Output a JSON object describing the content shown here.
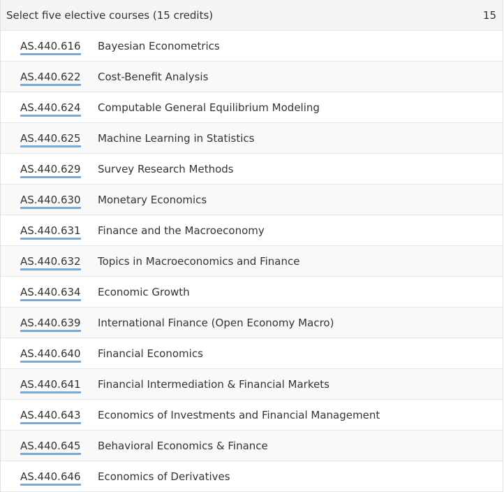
{
  "section": {
    "title": "Select five elective courses (15 credits)",
    "credits": "15"
  },
  "courses": [
    {
      "code": "AS.440.616",
      "title": "Bayesian Econometrics"
    },
    {
      "code": "AS.440.622",
      "title": "Cost-Benefit Analysis"
    },
    {
      "code": "AS.440.624",
      "title": "Computable General Equilibrium Modeling"
    },
    {
      "code": "AS.440.625",
      "title": "Machine Learning in Statistics"
    },
    {
      "code": "AS.440.629",
      "title": "Survey Research Methods"
    },
    {
      "code": "AS.440.630",
      "title": "Monetary Economics"
    },
    {
      "code": "AS.440.631",
      "title": "Finance and the Macroeconomy"
    },
    {
      "code": "AS.440.632",
      "title": "Topics in Macroeconomics and Finance"
    },
    {
      "code": "AS.440.634",
      "title": "Economic Growth"
    },
    {
      "code": "AS.440.639",
      "title": "International Finance (Open Economy Macro)"
    },
    {
      "code": "AS.440.640",
      "title": "Financial Economics"
    },
    {
      "code": "AS.440.641",
      "title": "Financial Intermediation & Financial Markets"
    },
    {
      "code": "AS.440.643",
      "title": "Economics of Investments and Financial Management"
    },
    {
      "code": "AS.440.645",
      "title": "Behavioral Economics & Finance"
    },
    {
      "code": "AS.440.646",
      "title": "Economics of Derivatives"
    }
  ],
  "colors": {
    "link_underline": "#7aa9d6",
    "header_bg": "#f5f5f5",
    "row_alt_bg": "#f9f9f9"
  }
}
